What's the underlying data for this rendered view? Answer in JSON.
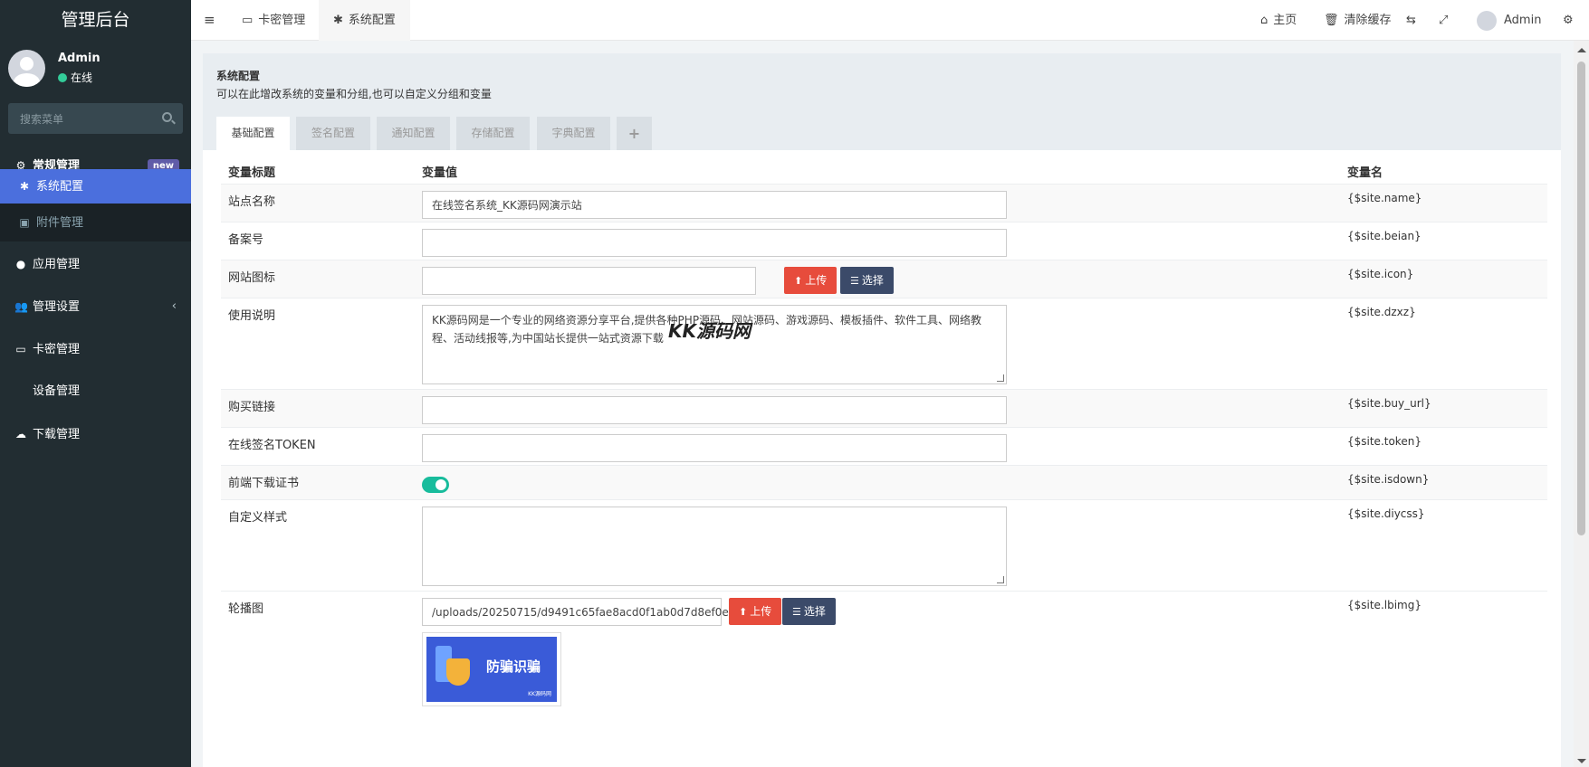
{
  "sidebar": {
    "logo": "管理后台",
    "user": {
      "name": "Admin",
      "status": "在线"
    },
    "search_placeholder": "搜索菜单",
    "menu": [
      {
        "label": "常规管理",
        "icon": "cogs-icon",
        "badge": "new"
      },
      {
        "label": "系统配置",
        "icon": "gear-icon"
      },
      {
        "label": "附件管理",
        "icon": "image-icon"
      },
      {
        "label": "应用管理",
        "icon": "circle-icon"
      },
      {
        "label": "管理设置",
        "icon": "users-icon"
      },
      {
        "label": "卡密管理",
        "icon": "card-icon"
      },
      {
        "label": "设备管理",
        "icon": "apple-icon"
      },
      {
        "label": "下载管理",
        "icon": "cloud-download-icon"
      }
    ]
  },
  "topbar": {
    "tabs": [
      {
        "label": "卡密管理",
        "icon": "card-icon"
      },
      {
        "label": "系统配置",
        "icon": "gear-icon"
      }
    ],
    "home": "主页",
    "clear_cache": "清除缓存",
    "user": "Admin"
  },
  "panel": {
    "title": "系统配置",
    "desc": "可以在此增改系统的变量和分组,也可以自定义分组和变量",
    "tabs": [
      "基础配置",
      "签名配置",
      "通知配置",
      "存储配置",
      "字典配置",
      "+"
    ]
  },
  "table": {
    "headers": [
      "变量标题",
      "变量值",
      "变量名"
    ],
    "rows": [
      {
        "title": "站点名称",
        "value": "在线签名系统_KK源码网演示站",
        "name": "{$site.name}"
      },
      {
        "title": "备案号",
        "value": "",
        "name": "{$site.beian}"
      },
      {
        "title": "网站图标",
        "value": "",
        "name": "{$site.icon}"
      },
      {
        "title": "使用说明",
        "value": "KK源码网是一个专业的网络资源分享平台,提供各种PHP源码、网站源码、游戏源码、模板插件、软件工具、网络教程、活动线报等,为中国站长提供一站式资源下载",
        "name": "{$site.dzxz}"
      },
      {
        "title": "购买链接",
        "value": "",
        "name": "{$site.buy_url}"
      },
      {
        "title": "在线签名TOKEN",
        "value": "",
        "name": "{$site.token}"
      },
      {
        "title": "前端下载证书",
        "value": "",
        "name": "{$site.isdown}"
      },
      {
        "title": "自定义样式",
        "value": "",
        "name": "{$site.diycss}"
      },
      {
        "title": "轮播图",
        "value": "/uploads/20250715/d9491c65fae8acd0f1ab0d7d8ef0e4d1.png",
        "name": "{$site.lbimg}"
      }
    ],
    "upload_label": "上传",
    "choose_label": "选择",
    "banner_title": "防骗识骗",
    "banner_brand": "KK源码网"
  },
  "watermark": "KK源码网"
}
